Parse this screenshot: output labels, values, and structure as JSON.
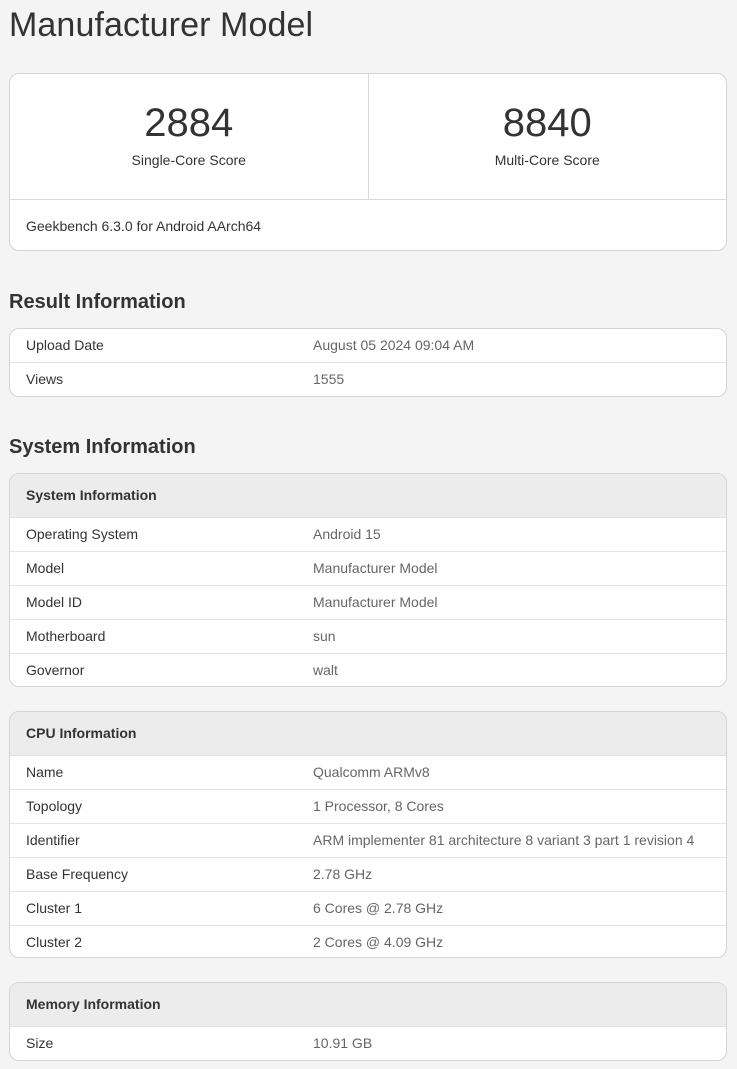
{
  "page": {
    "title": "Manufacturer Model"
  },
  "scores": {
    "single_core": {
      "value": "2884",
      "label": "Single-Core Score"
    },
    "multi_core": {
      "value": "8840",
      "label": "Multi-Core Score"
    },
    "version": "Geekbench 6.3.0 for Android AArch64"
  },
  "result_information": {
    "heading": "Result Information",
    "rows": [
      {
        "key": "Upload Date",
        "value": "August 05 2024 09:04 AM"
      },
      {
        "key": "Views",
        "value": "1555"
      }
    ]
  },
  "system_section": {
    "heading": "System Information"
  },
  "system_information": {
    "title": "System Information",
    "rows": [
      {
        "key": "Operating System",
        "value": "Android 15"
      },
      {
        "key": "Model",
        "value": "Manufacturer Model"
      },
      {
        "key": "Model ID",
        "value": "Manufacturer Model"
      },
      {
        "key": "Motherboard",
        "value": "sun"
      },
      {
        "key": "Governor",
        "value": "walt"
      }
    ]
  },
  "cpu_information": {
    "title": "CPU Information",
    "rows": [
      {
        "key": "Name",
        "value": "Qualcomm ARMv8"
      },
      {
        "key": "Topology",
        "value": "1 Processor, 8 Cores"
      },
      {
        "key": "Identifier",
        "value": "ARM implementer 81 architecture 8 variant 3 part 1 revision 4"
      },
      {
        "key": "Base Frequency",
        "value": "2.78 GHz"
      },
      {
        "key": "Cluster 1",
        "value": "6 Cores @ 2.78 GHz"
      },
      {
        "key": "Cluster 2",
        "value": "2 Cores @ 4.09 GHz"
      }
    ]
  },
  "memory_information": {
    "title": "Memory Information",
    "rows": [
      {
        "key": "Size",
        "value": "10.91 GB"
      }
    ]
  },
  "colors": {
    "background": "#f4f4f4",
    "card": "#ffffff",
    "border": "#d4d4d4",
    "table_header": "#ececec",
    "text": "#333333",
    "muted_text": "#666666"
  }
}
